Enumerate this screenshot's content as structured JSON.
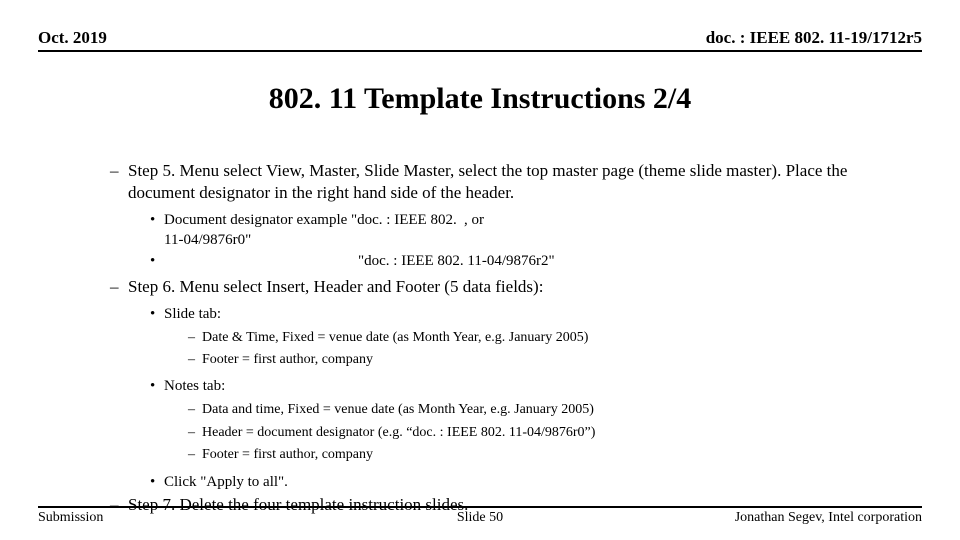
{
  "header": {
    "date": "Oct. 2019",
    "doc": "doc. : IEEE 802. 11-19/1712r5"
  },
  "title": "802. 11 Template Instructions 2/4",
  "step5": {
    "text": "Step 5. Menu select View, Master, Slide Master, select the top master page (theme slide master).  Place the document designator in the right hand side of the header.",
    "ex1_label": "Document designator example",
    "ex1_value": "\"doc. : IEEE 802. 11-04/9876r0\"",
    "ex1_suffix": ", or",
    "ex2_value": "\"doc. : IEEE 802. 11-04/9876r2\""
  },
  "step6": {
    "text": "Step 6. Menu select Insert, Header and Footer (5 data fields):",
    "slide_tab": "Slide tab:",
    "slide_items": {
      "a": "Date & Time, Fixed =  venue date (as Month Year, e.g. January 2005)",
      "b": "Footer = first author, company"
    },
    "notes_tab": "Notes tab:",
    "notes_items": {
      "a": "Data and time, Fixed = venue date (as Month Year, e.g. January 2005)",
      "b": "Header = document designator (e.g. “doc. : IEEE 802. 11-04/9876r0”)",
      "c": "Footer = first author, company"
    },
    "apply": "Click \"Apply to all\"."
  },
  "step7": "Step 7. Delete the four template instruction slides.",
  "footer": {
    "left": "Submission",
    "center": "Slide 50",
    "right": "Jonathan Segev, Intel corporation"
  }
}
